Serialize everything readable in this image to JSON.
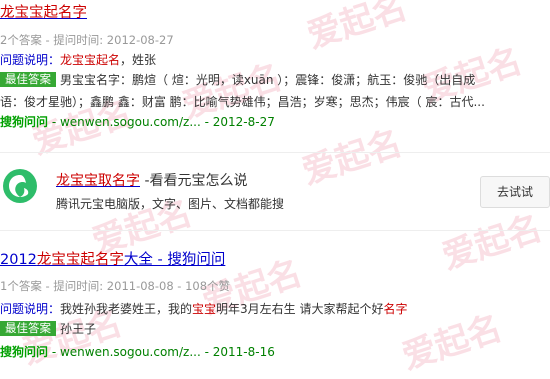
{
  "result1": {
    "title_hl": "龙宝宝起名字",
    "meta": "2个答案 - 提问时间: 2012-08-27",
    "question_label": "问题说明：",
    "question_hl": "龙宝宝起名",
    "question_rest": "，姓张",
    "best_badge": "最佳答案",
    "answer_line1": "男宝宝名字：鹏煊（ 煊：光明，读xuān ）；震锋：俊潇；航玉：俊驰（出自成",
    "answer_line2": "语：俊才星驰）；鑫鹏 鑫：财富 鹏：比喻气势雄伟；昌浩；岁寒；思杰；伟宸（ 宸：古代...",
    "source_bold": "搜狗问问",
    "source_rest": " - wenwen.sogou.com/z... - 2012-8-27"
  },
  "ad": {
    "title_hl": "龙宝宝取名字",
    "title_rest": " -看看元宝怎么说",
    "desc": "腾讯元宝电脑版，文字、图片、文档都能搜",
    "button": "去试试"
  },
  "result2": {
    "title_pre": "2012",
    "title_hl": "龙宝宝起名字",
    "title_rest": "大全 - 搜狗问问",
    "meta": "1个答案 - 提问时间: 2011-08-08 - 108个赞",
    "question_label": "问题说明：",
    "question_a": "我姓孙我老婆姓王，我的",
    "question_hl": "宝宝",
    "question_b": "明年3月左右生 请大家帮起个好",
    "question_hl2": "名字",
    "best_badge": "最佳答案",
    "answer": "孙王子",
    "source_bold": "搜狗问问",
    "source_rest": " - wenwen.sogou.com/z... - 2011-8-16"
  },
  "watermark": "爱起名",
  "colors": {
    "link": "#0000cc",
    "highlight": "#cc0000",
    "green": "#008000",
    "badge": "#36a834"
  }
}
